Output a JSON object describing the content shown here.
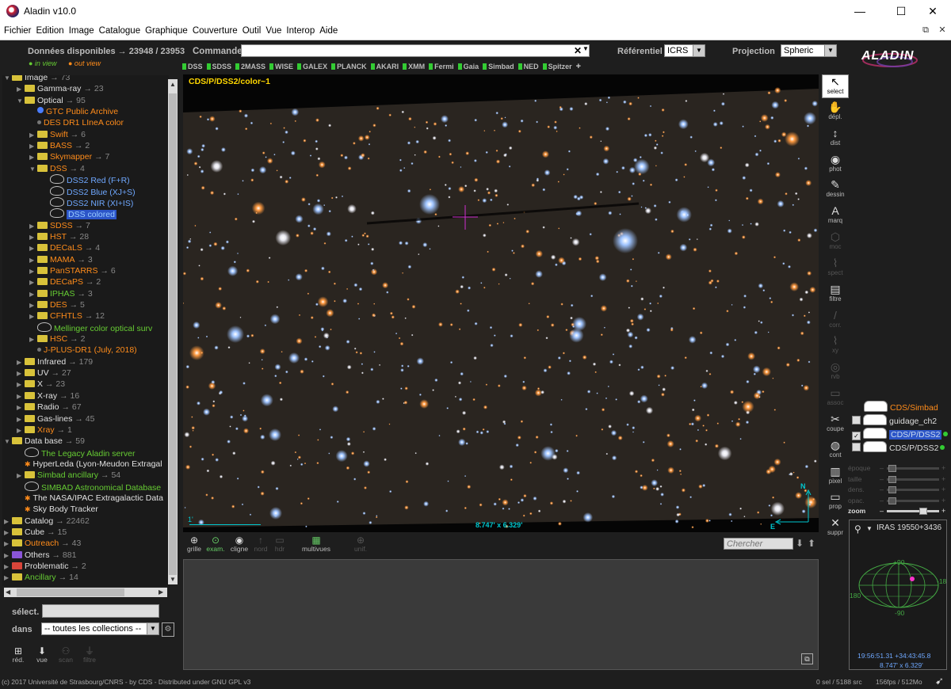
{
  "window": {
    "title": "Aladin v10.0"
  },
  "menu": [
    "Fichier",
    "Edition",
    "Image",
    "Catalogue",
    "Graphique",
    "Couverture",
    "Outil",
    "Vue",
    "Interop",
    "Aide"
  ],
  "header": {
    "available_label": "Données disponibles → 23948 / 23953",
    "in_view": "● in view",
    "out_view": "● out view",
    "command_label": "Commande",
    "command_value": "",
    "referentiel_label": "Référentiel",
    "referentiel_value": "ICRS",
    "projection_label": "Projection",
    "projection_value": "Spheric",
    "logo": "ALADIN",
    "surveys": [
      "DSS",
      "SDSS",
      "2MASS",
      "WISE",
      "GALEX",
      "PLANCK",
      "AKARI",
      "XMM",
      "Fermi",
      "Gaia",
      "Simbad",
      "NED",
      "Spitzer"
    ],
    "add_survey": "+"
  },
  "tree": {
    "nodes": [
      {
        "indent": 1,
        "tw": "▼",
        "icon": "folder",
        "text": "Image",
        "count": "→ 73",
        "color": "white"
      },
      {
        "indent": 2,
        "tw": "▶",
        "icon": "folder",
        "text": "Gamma-ray",
        "count": "→ 23",
        "color": "white"
      },
      {
        "indent": 2,
        "tw": "▼",
        "icon": "folder",
        "text": "Optical",
        "count": "→ 95",
        "color": "white"
      },
      {
        "indent": 3,
        "tw": "",
        "icon": "dot-blue",
        "text": "GTC Public Archive",
        "count": "",
        "color": "orange"
      },
      {
        "indent": 3,
        "tw": "",
        "icon": "dot",
        "text": "DES DR1 LIneA color",
        "count": "",
        "color": "orange"
      },
      {
        "indent": 3,
        "tw": "▶",
        "icon": "folder",
        "text": "Swift",
        "count": "→ 6",
        "color": "orange"
      },
      {
        "indent": 3,
        "tw": "▶",
        "icon": "folder",
        "text": "BASS",
        "count": "→ 2",
        "color": "orange"
      },
      {
        "indent": 3,
        "tw": "▶",
        "icon": "folder",
        "text": "Skymapper",
        "count": "→ 7",
        "color": "orange"
      },
      {
        "indent": 3,
        "tw": "▼",
        "icon": "folder",
        "text": "DSS",
        "count": "→ 4",
        "color": "orange"
      },
      {
        "indent": 4,
        "tw": "",
        "icon": "survey",
        "text": "DSS2 Red (F+R)",
        "count": "",
        "color": "blue"
      },
      {
        "indent": 4,
        "tw": "",
        "icon": "survey",
        "text": "DSS2 Blue (XJ+S)",
        "count": "",
        "color": "blue"
      },
      {
        "indent": 4,
        "tw": "",
        "icon": "survey",
        "text": "DSS2 NIR (XI+IS)",
        "count": "",
        "color": "blue"
      },
      {
        "indent": 4,
        "tw": "",
        "icon": "survey",
        "text": "DSS colored",
        "count": "",
        "color": "selected"
      },
      {
        "indent": 3,
        "tw": "▶",
        "icon": "folder",
        "text": "SDSS",
        "count": "→ 7",
        "color": "orange"
      },
      {
        "indent": 3,
        "tw": "▶",
        "icon": "folder",
        "text": "HST",
        "count": "→ 28",
        "color": "orange"
      },
      {
        "indent": 3,
        "tw": "▶",
        "icon": "folder",
        "text": "DECaLS",
        "count": "→ 4",
        "color": "orange"
      },
      {
        "indent": 3,
        "tw": "▶",
        "icon": "folder",
        "text": "MAMA",
        "count": "→ 3",
        "color": "orange"
      },
      {
        "indent": 3,
        "tw": "▶",
        "icon": "folder",
        "text": "PanSTARRS",
        "count": "→ 6",
        "color": "orange"
      },
      {
        "indent": 3,
        "tw": "▶",
        "icon": "folder",
        "text": "DECaPS",
        "count": "→ 2",
        "color": "orange"
      },
      {
        "indent": 3,
        "tw": "▶",
        "icon": "folder",
        "text": "IPHAS",
        "count": "→ 3",
        "color": "green"
      },
      {
        "indent": 3,
        "tw": "▶",
        "icon": "folder",
        "text": "DES",
        "count": "→ 5",
        "color": "orange"
      },
      {
        "indent": 3,
        "tw": "▶",
        "icon": "folder",
        "text": "CFHTLS",
        "count": "→ 12",
        "color": "orange"
      },
      {
        "indent": 3,
        "tw": "",
        "icon": "survey",
        "text": "Mellinger color optical surv",
        "count": "",
        "color": "green"
      },
      {
        "indent": 3,
        "tw": "▶",
        "icon": "folder",
        "text": "HSC",
        "count": "→ 2",
        "color": "orange"
      },
      {
        "indent": 3,
        "tw": "",
        "icon": "dot",
        "text": "J-PLUS-DR1 (July, 2018)",
        "count": "",
        "color": "orange"
      },
      {
        "indent": 2,
        "tw": "▶",
        "icon": "folder",
        "text": "Infrared",
        "count": "→ 179",
        "color": "white"
      },
      {
        "indent": 2,
        "tw": "▶",
        "icon": "folder",
        "text": "UV",
        "count": "→ 27",
        "color": "white"
      },
      {
        "indent": 2,
        "tw": "▶",
        "icon": "folder",
        "text": "X",
        "count": "→ 23",
        "color": "white"
      },
      {
        "indent": 2,
        "tw": "▶",
        "icon": "folder",
        "text": "X-ray",
        "count": "→ 16",
        "color": "white"
      },
      {
        "indent": 2,
        "tw": "▶",
        "icon": "folder",
        "text": "Radio",
        "count": "→ 67",
        "color": "white"
      },
      {
        "indent": 2,
        "tw": "▶",
        "icon": "folder",
        "text": "Gas-lines",
        "count": "→ 45",
        "color": "white"
      },
      {
        "indent": 2,
        "tw": "▶",
        "icon": "folder",
        "text": "Xray",
        "count": "→ 1",
        "color": "orange"
      },
      {
        "indent": 1,
        "tw": "▼",
        "icon": "folder",
        "text": "Data base",
        "count": "→ 59",
        "color": "white"
      },
      {
        "indent": 2,
        "tw": "",
        "icon": "survey",
        "text": "The Legacy Aladin server",
        "count": "",
        "color": "green"
      },
      {
        "indent": 2,
        "tw": "",
        "icon": "star",
        "text": "HyperLeda (Lyon-Meudon Extragal",
        "count": "",
        "color": "white"
      },
      {
        "indent": 2,
        "tw": "▶",
        "icon": "folder",
        "text": "Simbad ancillary",
        "count": "→ 54",
        "color": "green"
      },
      {
        "indent": 2,
        "tw": "",
        "icon": "survey",
        "text": "SIMBAD Astronomical Database",
        "count": "",
        "color": "green"
      },
      {
        "indent": 2,
        "tw": "",
        "icon": "star",
        "text": "The NASA/IPAC Extragalactic Data",
        "count": "",
        "color": "white"
      },
      {
        "indent": 2,
        "tw": "",
        "icon": "star",
        "text": "Sky Body Tracker",
        "count": "",
        "color": "white"
      },
      {
        "indent": 1,
        "tw": "▶",
        "icon": "folder",
        "text": "Catalog",
        "count": "→ 22462",
        "color": "white"
      },
      {
        "indent": 1,
        "tw": "▶",
        "icon": "folder",
        "text": "Cube",
        "count": "→ 15",
        "color": "white"
      },
      {
        "indent": 1,
        "tw": "▶",
        "icon": "folder",
        "text": "Outreach",
        "count": "→ 43",
        "color": "orange"
      },
      {
        "indent": 1,
        "tw": "▶",
        "icon": "folder-purple",
        "text": "Others",
        "count": "→ 881",
        "color": "white"
      },
      {
        "indent": 1,
        "tw": "▶",
        "icon": "folder-red",
        "text": "Problematic",
        "count": "→ 2",
        "color": "white"
      },
      {
        "indent": 1,
        "tw": "▶",
        "icon": "folder",
        "text": "Ancillary",
        "count": "→ 14",
        "color": "green"
      }
    ],
    "select_label": "sélect.",
    "select_value": "",
    "dans_label": "dans",
    "collection_value": "-- toutes les collections --",
    "bottom_tools": [
      "réd.",
      "vue",
      "scan",
      "filtre"
    ]
  },
  "view": {
    "label": "CDS/P/DSS2/color~1",
    "scale_label": "1'",
    "fov": "8.747' x 6.329'",
    "north": "N",
    "east": "E"
  },
  "tools": [
    {
      "g": "↖",
      "label": "select",
      "state": "active"
    },
    {
      "g": "✋",
      "label": "dépl.",
      "state": "on"
    },
    {
      "g": "↕",
      "label": "dist",
      "state": "on"
    },
    {
      "g": "◉",
      "label": "phot",
      "state": "on"
    },
    {
      "g": "✎",
      "label": "dessin",
      "state": "on"
    },
    {
      "g": "A",
      "label": "marq",
      "state": "on"
    },
    {
      "g": "⬡",
      "label": "moc",
      "state": "dim"
    },
    {
      "g": "⌇",
      "label": "spect",
      "state": "dim"
    },
    {
      "g": "▤",
      "label": "filtre",
      "state": "on"
    },
    {
      "g": "/",
      "label": "corr.",
      "state": "dim"
    },
    {
      "g": "⌇",
      "label": "xy",
      "state": "dim"
    },
    {
      "g": "◎",
      "label": "rvb",
      "state": "dim"
    },
    {
      "g": "▭",
      "label": "assoc",
      "state": "dim"
    },
    {
      "g": "✂",
      "label": "coupe",
      "state": "on"
    },
    {
      "g": "◍",
      "label": "cont",
      "state": "on"
    },
    {
      "g": "▥",
      "label": "pixel",
      "state": "on"
    },
    {
      "g": "▭",
      "label": "prop",
      "state": "on"
    },
    {
      "g": "✕",
      "label": "suppr",
      "state": "on"
    }
  ],
  "layers": [
    {
      "name": "CDS/Simbad",
      "checked": "none",
      "color": "orange"
    },
    {
      "name": "guidage_ch2",
      "checked": "off",
      "color": "white"
    },
    {
      "name": "CDS/P/DSS2",
      "checked": "on",
      "color": "selected"
    },
    {
      "name": "CDS/P/DSS2",
      "checked": "off",
      "color": "white"
    }
  ],
  "sliders": {
    "labels": [
      "époque",
      "taille",
      "dens.",
      "opac.",
      "zoom"
    ]
  },
  "view_tools": {
    "items": [
      {
        "g": "⊕",
        "label": "grille",
        "state": "on"
      },
      {
        "g": "⊙",
        "label": "exam.",
        "state": "on"
      },
      {
        "g": "◉",
        "label": "cligne",
        "state": "on"
      },
      {
        "g": "↑",
        "label": "nord",
        "state": "dim"
      },
      {
        "g": "▭",
        "label": "hdr",
        "state": "dim"
      },
      {
        "g": "▦",
        "label": "multivues",
        "state": "on"
      },
      {
        "g": "⊕",
        "label": "unif.",
        "state": "dim"
      }
    ],
    "search_placeholder": "Chercher"
  },
  "minimap": {
    "target": "IRAS 19550+3436",
    "lat_top": "+90",
    "lat_bottom": "-90",
    "lon_left": "180",
    "lon_right": "-18",
    "coords": "19:56:51.31 +34:43:45.8",
    "fov": "8.747' x 6.329'"
  },
  "status": {
    "left": "(c) 2017 Université de Strasbourg/CNRS - by CDS - Distributed under GNU GPL v3",
    "sel": "0 sel / 5188 src",
    "perf": "156fps / 512Mo"
  },
  "colors": {
    "accent": "#2c55c8",
    "orange": "#ff8c1a",
    "green": "#66cc33",
    "label_yellow": "#ffd700",
    "cyan": "#00c8d0"
  }
}
